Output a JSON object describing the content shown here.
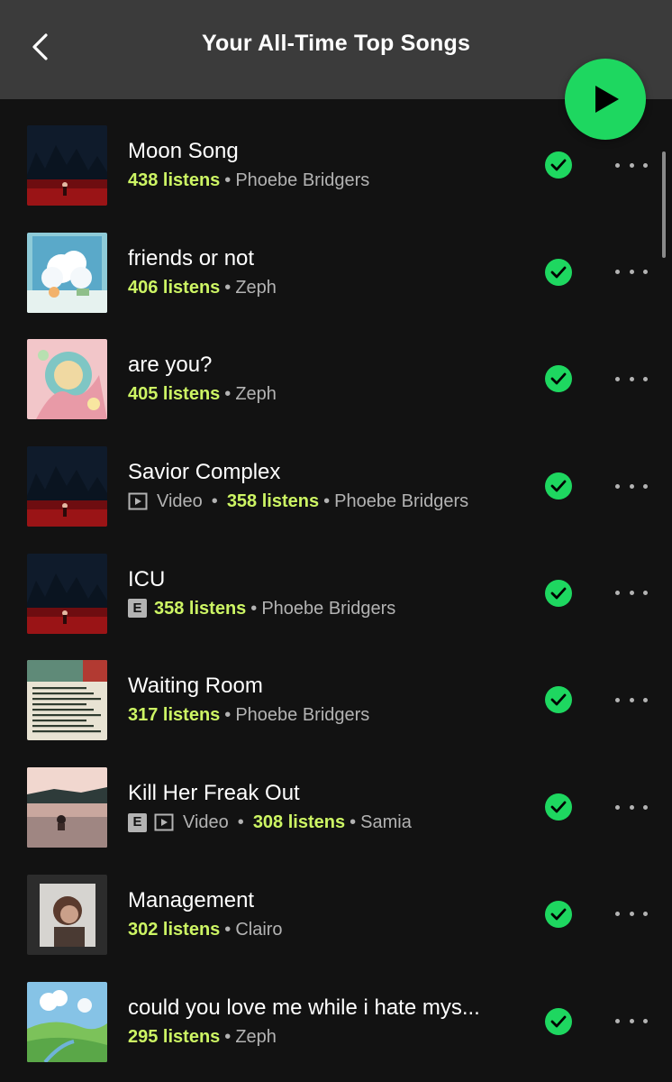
{
  "header": {
    "title": "Your All-Time Top Songs",
    "back_icon": "chevron-left-icon",
    "play_icon": "play-icon"
  },
  "colors": {
    "accent": "#1ed760",
    "listens": "#cdf564",
    "background": "#121212",
    "header": "#3b3b3b"
  },
  "songs": [
    {
      "title": "Moon Song",
      "listens": "438 listens",
      "artist": "Phoebe Bridgers",
      "explicit": false,
      "video": false,
      "video_label": "Video",
      "art": "night-red"
    },
    {
      "title": "friends or not",
      "listens": "406 listens",
      "artist": "Zeph",
      "explicit": false,
      "video": false,
      "video_label": "Video",
      "art": "clouds"
    },
    {
      "title": "are you?",
      "listens": "405 listens",
      "artist": "Zeph",
      "explicit": false,
      "video": false,
      "video_label": "Video",
      "art": "pastel"
    },
    {
      "title": "Savior Complex",
      "listens": "358 listens",
      "artist": "Phoebe Bridgers",
      "explicit": false,
      "video": true,
      "video_label": "Video",
      "art": "night-red"
    },
    {
      "title": "ICU",
      "listens": "358 listens",
      "artist": "Phoebe Bridgers",
      "explicit": true,
      "video": false,
      "video_label": "Video",
      "art": "night-red"
    },
    {
      "title": "Waiting Room",
      "listens": "317 listens",
      "artist": "Phoebe Bridgers",
      "explicit": false,
      "video": false,
      "video_label": "Video",
      "art": "poster"
    },
    {
      "title": "Kill Her Freak Out",
      "listens": "308 listens",
      "artist": "Samia",
      "explicit": true,
      "video": true,
      "video_label": "Video",
      "art": "lake"
    },
    {
      "title": "Management",
      "listens": "302 listens",
      "artist": "Clairo",
      "explicit": false,
      "video": false,
      "video_label": "Video",
      "art": "portrait"
    },
    {
      "title": "could you love me while i hate mys...",
      "listens": "295 listens",
      "artist": "Zeph",
      "explicit": false,
      "video": false,
      "video_label": "Video",
      "art": "meadow"
    }
  ],
  "explicit_label": "E",
  "poster_art_text": "LOST ARK STUDIO"
}
